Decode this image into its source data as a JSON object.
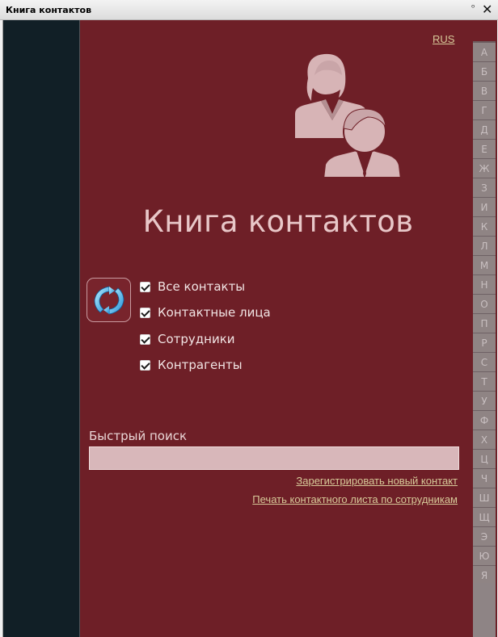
{
  "window": {
    "title": "Книга контактов",
    "pin_glyph": "ᵒ",
    "close_glyph": "✕"
  },
  "language_link": "RUS",
  "heading": "Книга контактов",
  "filters": [
    {
      "label": "Все контакты",
      "checked": true
    },
    {
      "label": "Контактные лица",
      "checked": true
    },
    {
      "label": "Сотрудники",
      "checked": true
    },
    {
      "label": "Контрагенты",
      "checked": true
    }
  ],
  "search": {
    "label": "Быстрый поиск",
    "value": ""
  },
  "links": {
    "register_contact": "Зарегистрировать новый контакт",
    "print_sheet": "Печать контактного листа по сотрудникам"
  },
  "alphabet": [
    "А",
    "Б",
    "В",
    "Г",
    "Д",
    "Е",
    "Ж",
    "З",
    "И",
    "К",
    "Л",
    "М",
    "Н",
    "О",
    "П",
    "Р",
    "С",
    "Т",
    "У",
    "Ф",
    "Х",
    "Ц",
    "Ч",
    "Ш",
    "Щ",
    "Э",
    "Ю",
    "Я"
  ],
  "icons": {
    "people": "contacts-people-icon",
    "refresh": "refresh-icon",
    "checkbox": "checkbox-checked-icon"
  },
  "colors": {
    "background": "#6e1f27",
    "sidebar": "#111f26",
    "link": "#d7c999",
    "heading": "#e8c7c8",
    "alphabet_bg": "#8f8484",
    "search_field": "#d8b7ba"
  }
}
